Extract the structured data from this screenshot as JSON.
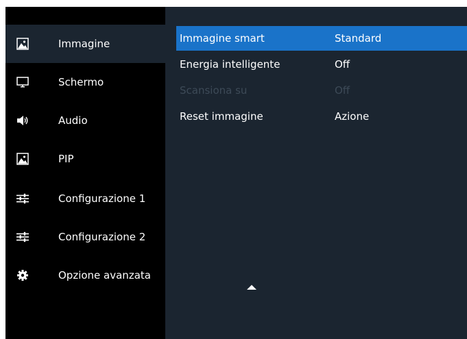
{
  "sidebar": {
    "items": [
      {
        "label": "Immagine",
        "icon": "picture-icon",
        "active": true
      },
      {
        "label": "Schermo",
        "icon": "monitor-icon",
        "active": false
      },
      {
        "label": "Audio",
        "icon": "speaker-icon",
        "active": false
      },
      {
        "label": "PIP",
        "icon": "picture-in-picture-icon",
        "active": false
      },
      {
        "label": "Configurazione 1",
        "icon": "sliders-icon",
        "active": false
      },
      {
        "label": "Configurazione 2",
        "icon": "sliders-icon",
        "active": false
      },
      {
        "label": "Opzione avanzata",
        "icon": "gear-icon",
        "active": false
      }
    ]
  },
  "menu": {
    "rows": [
      {
        "name": "Immagine smart",
        "value": "Standard",
        "state": "selected"
      },
      {
        "name": "Energia intelligente",
        "value": "Off",
        "state": "normal"
      },
      {
        "name": "Scansiona su",
        "value": "Off",
        "state": "disabled"
      },
      {
        "name": "Reset immagine",
        "value": "Azione",
        "state": "normal"
      }
    ],
    "scroll_icon": "up-arrow-icon"
  },
  "colors": {
    "sidebar_background": "#000000",
    "panel_background": "#1b2530",
    "selection": "#1a73c9",
    "text": "#ffffff",
    "disabled_text": "#3d4a57"
  }
}
